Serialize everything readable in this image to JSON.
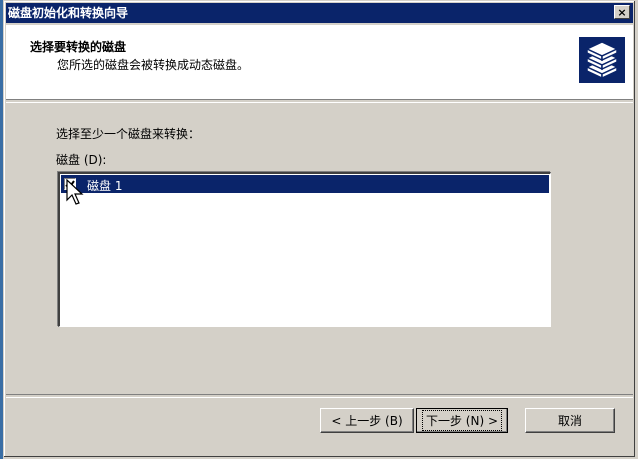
{
  "window": {
    "title": "磁盘初始化和转换向导",
    "close_glyph": "×"
  },
  "header": {
    "title": "选择要转换的磁盘",
    "subtitle": "您所选的磁盘会被转换成动态磁盘。",
    "icon": "disk-stack-icon"
  },
  "main": {
    "prompt": "选择至少一个磁盘来转换：",
    "disk_list_label": "磁盘 (D):",
    "disks": [
      {
        "label": "磁盘 1",
        "checked": true,
        "selected": true
      }
    ]
  },
  "buttons": {
    "back": "< 上一步 (B)",
    "next": "下一步 (N) >",
    "cancel": "取消"
  },
  "colors": {
    "titlebar": "#0a246a",
    "selection": "#0a246a",
    "face": "#d4d0c8"
  }
}
